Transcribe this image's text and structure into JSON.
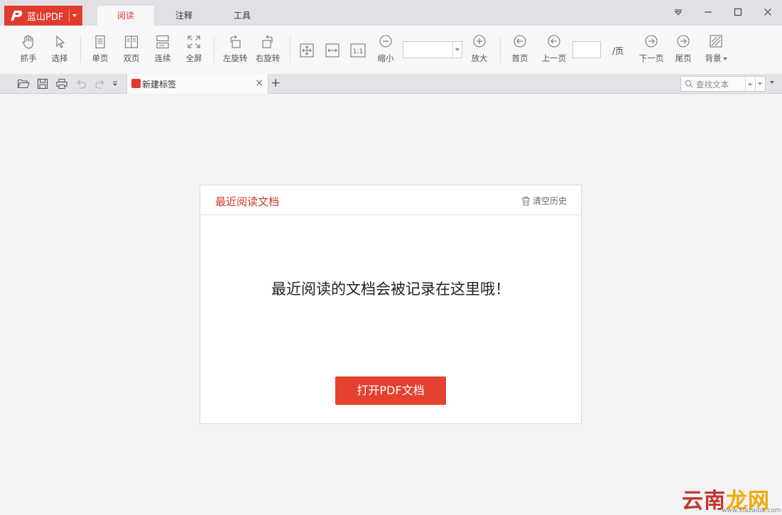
{
  "titlebar": {
    "app_name": "蓝山PDF",
    "tabs": [
      {
        "label": "阅读",
        "active": true
      },
      {
        "label": "注释",
        "active": false
      },
      {
        "label": "工具",
        "active": false
      }
    ]
  },
  "toolbar": {
    "grab": "抓手",
    "select": "选择",
    "single_page": "单页",
    "double_page": "双页",
    "continuous": "连续",
    "fullscreen": "全屏",
    "rotate_left": "左旋转",
    "rotate_right": "右旋转",
    "zoom_out": "缩小",
    "zoom_in": "放大",
    "actual_size_label": "1:1",
    "first_page": "首页",
    "prev_page": "上一页",
    "page_suffix": "/页",
    "next_page": "下一页",
    "last_page": "尾页",
    "background": "背景"
  },
  "tabstrip": {
    "doc_tab_title": "新建标签",
    "search_placeholder": "查找文本"
  },
  "recent": {
    "title": "最近阅读文档",
    "clear_history": "清空历史",
    "empty_message": "最近阅读的文档会被记录在这里哦！",
    "open_button": "打开PDF文档"
  },
  "watermark": {
    "text_prefix": "云南",
    "text_suffix": "龙网",
    "sub": "www.xiazaiba.com"
  },
  "colors": {
    "accent": "#e23b2e",
    "button": "#e5412f",
    "title_text": "#c9392c"
  }
}
